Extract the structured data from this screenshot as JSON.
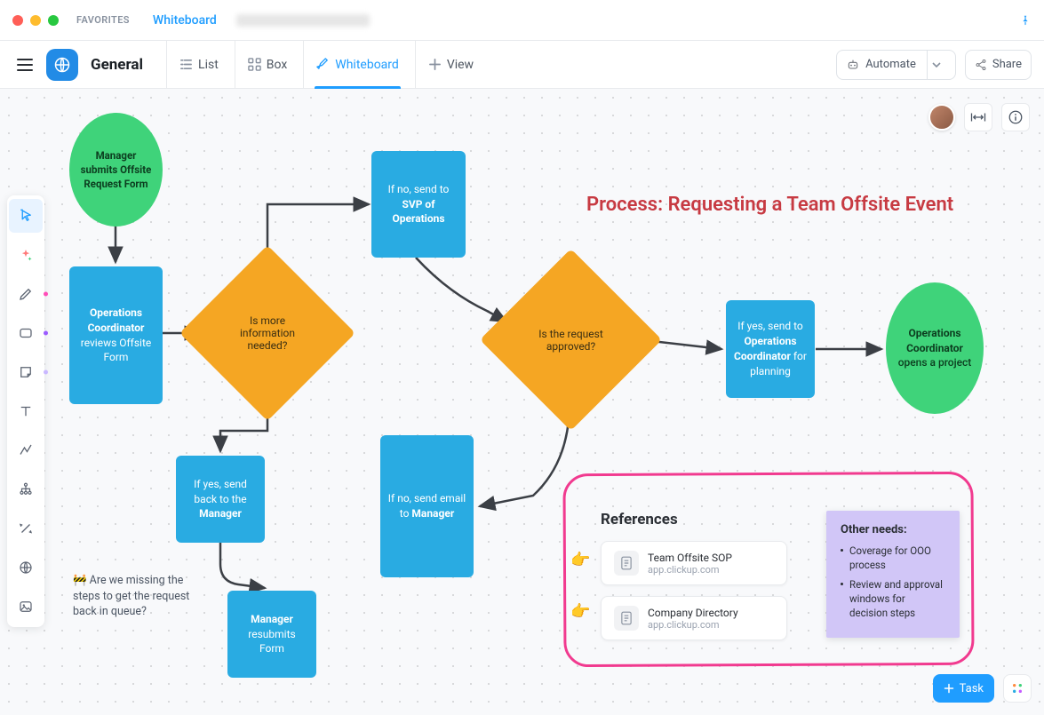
{
  "titlebar": {
    "favorites_label": "FAVORITES",
    "tabs": [
      {
        "label": "Whiteboard",
        "active": true
      }
    ]
  },
  "toolbar": {
    "space_title": "General",
    "views": [
      {
        "label": "List",
        "icon": "list-icon",
        "active": false
      },
      {
        "label": "Box",
        "icon": "grid-icon",
        "active": false
      },
      {
        "label": "Whiteboard",
        "icon": "pencil-icon",
        "active": true
      },
      {
        "label": "View",
        "icon": "plus-icon",
        "active": false
      }
    ],
    "automate_label": "Automate",
    "share_label": "Share"
  },
  "process_title": "Process: Requesting a Team Offsite Event",
  "shapes": {
    "start": {
      "line1": "Manager submits Offsite Request Form"
    },
    "review": {
      "bold": "Operations Coordinator",
      "rest": " reviews Offsite Form"
    },
    "decision1": "Is more information needed?",
    "send_back": {
      "pre": "If yes, send back to the ",
      "bold": "Manager"
    },
    "resubmit": {
      "bold": "Manager",
      "rest": " resubmits Form"
    },
    "send_svp": {
      "pre": "If no, send to ",
      "bold": "SVP of Operations"
    },
    "decision2": "Is the request approved?",
    "send_email": {
      "pre": "If no, send email to ",
      "bold": "Manager"
    },
    "send_planning": {
      "pre": "If yes, send to ",
      "bold": "Operations Coordinator",
      "post": " for planning"
    },
    "end": {
      "bold": "Operations Coordinator",
      "rest": " opens a project"
    }
  },
  "comment": "🚧 Are we missing the steps to get the request back in queue?",
  "references": {
    "title": "References",
    "items": [
      {
        "title": "Team Offsite SOP",
        "subtitle": "app.clickup.com"
      },
      {
        "title": "Company Directory",
        "subtitle": "app.clickup.com"
      }
    ]
  },
  "sticky": {
    "heading": "Other needs:",
    "items": [
      "Coverage for OOO process",
      "Review and approval windows for decision steps"
    ]
  },
  "task_button": "Task"
}
